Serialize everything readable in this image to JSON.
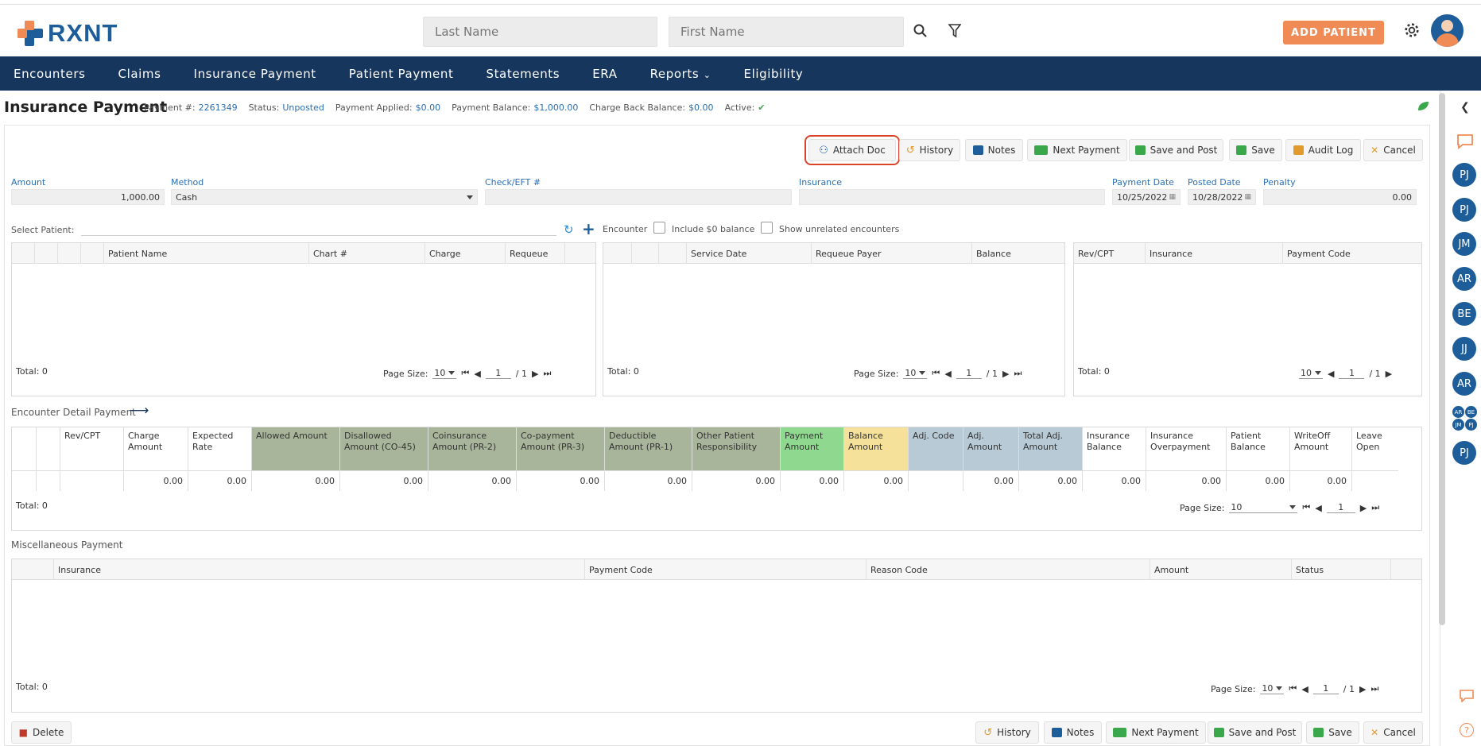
{
  "header": {
    "logo_text": "RXNT",
    "last_name_placeholder": "Last Name",
    "first_name_placeholder": "First Name",
    "add_patient": "ADD PATIENT"
  },
  "nav": [
    "Encounters",
    "Claims",
    "Insurance Payment",
    "Patient Payment",
    "Statements",
    "ERA",
    "Reports",
    "Eligibility"
  ],
  "page": {
    "title": "Insurance Payment",
    "meta": [
      {
        "label": "Payment #:",
        "value": "2261349"
      },
      {
        "label": "Status:",
        "value": "Unposted"
      },
      {
        "label": "Payment Applied:",
        "value": "$0.00"
      },
      {
        "label": "Payment Balance:",
        "value": "$1,000.00"
      },
      {
        "label": "Charge Back Balance:",
        "value": "$0.00"
      },
      {
        "label": "Active:",
        "value": "✔"
      }
    ]
  },
  "toolbar": {
    "attach_doc": "Attach Doc",
    "history": "History",
    "notes": "Notes",
    "next_payment": "Next Payment",
    "save_and_post": "Save and Post",
    "save": "Save",
    "audit_log": "Audit Log",
    "cancel": "Cancel"
  },
  "form": {
    "amount_label": "Amount",
    "amount_value": "1,000.00",
    "method_label": "Method",
    "method_value": "Cash",
    "check_label": "Check/EFT #",
    "insurance_label": "Insurance",
    "payment_date_label": "Payment Date",
    "payment_date_value": "10/25/2022",
    "posted_date_label": "Posted Date",
    "posted_date_value": "10/28/2022",
    "penalty_label": "Penalty",
    "penalty_value": "0.00"
  },
  "patients": {
    "select_label": "Select Patient:",
    "columns": [
      "Patient Name",
      "Chart #",
      "Charge",
      "Requeue"
    ],
    "total": "Total: 0",
    "page_size_label": "Page Size:",
    "page_size": "10",
    "page": "1",
    "page_of": "/ 1"
  },
  "encounters": {
    "label": "Encounter",
    "include_zero": "Include $0 balance",
    "show_unrelated": "Show unrelated encounters",
    "columns": [
      "Service Date",
      "Requeue Payer",
      "Balance"
    ],
    "total": "Total: 0",
    "page_size_label": "Page Size:",
    "page_size": "10",
    "page": "1",
    "page_of": "/ 1"
  },
  "revcpt": {
    "columns": [
      "Rev/CPT",
      "Insurance",
      "Payment Code"
    ],
    "total": "Total: 0",
    "page_size": "10",
    "page": "1",
    "page_of": "/ 1"
  },
  "detail": {
    "title": "Encounter Detail Payment",
    "columns": [
      {
        "label": "Rev/CPT",
        "bg": "#ffffff",
        "value": ""
      },
      {
        "label": "Charge Amount",
        "bg": "#ffffff",
        "value": "0.00"
      },
      {
        "label": "Expected Rate",
        "bg": "#ffffff",
        "value": "0.00"
      },
      {
        "label": "Allowed Amount",
        "bg": "#a9b59a",
        "value": "0.00"
      },
      {
        "label": "Disallowed Amount (CO-45)",
        "bg": "#a9b59a",
        "value": "0.00"
      },
      {
        "label": "Coinsurance Amount (PR-2)",
        "bg": "#a9b59a",
        "value": "0.00"
      },
      {
        "label": "Co-payment Amount (PR-3)",
        "bg": "#a9b59a",
        "value": "0.00"
      },
      {
        "label": "Deductible Amount (PR-1)",
        "bg": "#a9b59a",
        "value": "0.00"
      },
      {
        "label": "Other Patient Responsibility",
        "bg": "#a9b59a",
        "value": "0.00"
      },
      {
        "label": "Payment Amount",
        "bg": "#8fd88f",
        "value": "0.00"
      },
      {
        "label": "Balance Amount",
        "bg": "#f6e19a",
        "value": "0.00"
      },
      {
        "label": "Adj. Code",
        "bg": "#b7cad6",
        "value": ""
      },
      {
        "label": "Adj. Amount",
        "bg": "#b7cad6",
        "value": "0.00"
      },
      {
        "label": "Total Adj. Amount",
        "bg": "#b7cad6",
        "value": "0.00"
      },
      {
        "label": "Insurance Balance",
        "bg": "#ffffff",
        "value": "0.00"
      },
      {
        "label": "Insurance Overpayment",
        "bg": "#ffffff",
        "value": "0.00"
      },
      {
        "label": "Patient Balance",
        "bg": "#ffffff",
        "value": "0.00"
      },
      {
        "label": "WriteOff Amount",
        "bg": "#ffffff",
        "value": "0.00"
      },
      {
        "label": "Leave Open",
        "bg": "#ffffff",
        "value": ""
      }
    ],
    "total": "Total: 0",
    "page_size_label": "Page Size:",
    "page_size": "10",
    "page": "1"
  },
  "misc": {
    "title": "Miscellaneous Payment",
    "columns": [
      "Insurance",
      "Payment Code",
      "Reason Code",
      "Amount",
      "Status"
    ],
    "total": "Total: 0",
    "page_size_label": "Page Size:",
    "page_size": "10",
    "page": "1",
    "page_of": "/ 1"
  },
  "footer": {
    "delete": "Delete",
    "history": "History",
    "notes": "Notes",
    "next_payment": "Next Payment",
    "save_and_post": "Save and Post",
    "save": "Save",
    "cancel": "Cancel"
  },
  "sidebar": {
    "avatars": [
      "PJ",
      "PJ",
      "JM",
      "AR",
      "BE",
      "JJ",
      "AR",
      "PJ"
    ],
    "mini": [
      "AR",
      "BE",
      "JM",
      "PJ"
    ]
  },
  "colors": {
    "brand": "#1d5d99",
    "nav": "#17365d",
    "accent": "#f08b55",
    "highlight": "#d9442b"
  }
}
